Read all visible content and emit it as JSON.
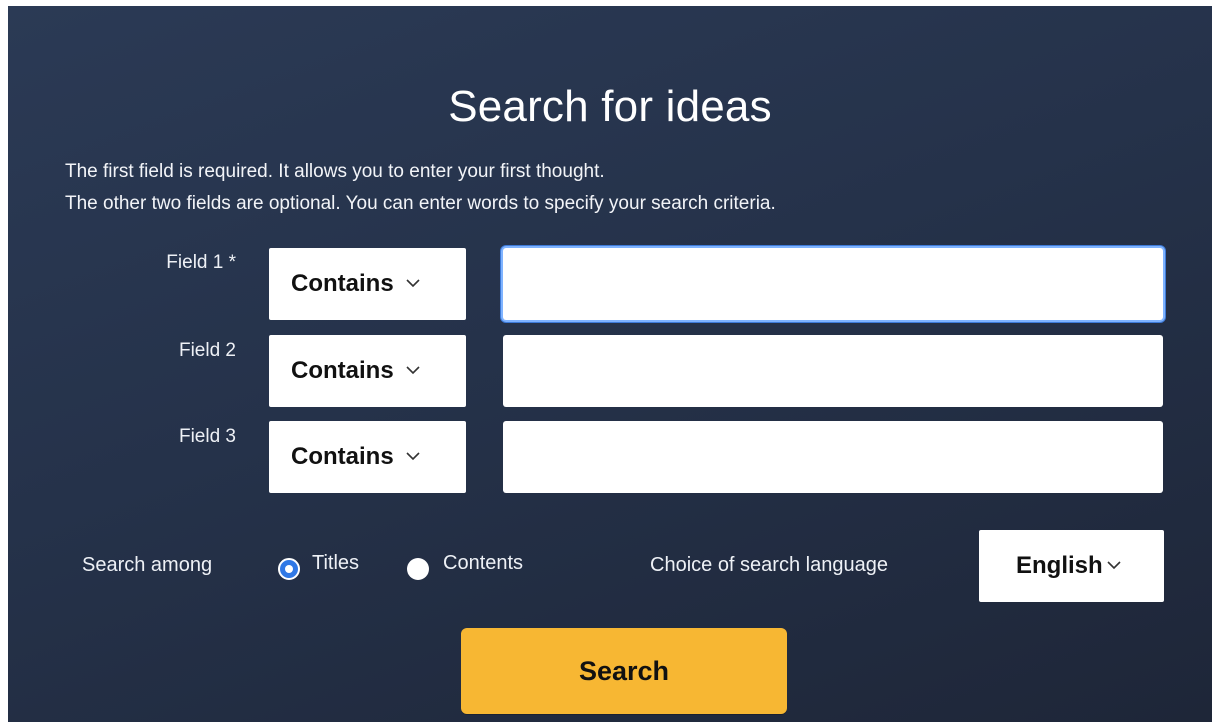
{
  "page": {
    "title": "Search for ideas",
    "description": [
      "The first field is required. It allows you to enter your first thought.",
      "The other two fields are optional. You can enter words to specify your search criteria."
    ]
  },
  "fields": [
    {
      "label": "Field 1 *",
      "operator": "Contains",
      "value": "",
      "focused": true
    },
    {
      "label": "Field 2",
      "operator": "Contains",
      "value": ""
    },
    {
      "label": "Field 3",
      "operator": "Contains",
      "value": ""
    }
  ],
  "search_among": {
    "label": "Search among",
    "options": [
      {
        "label": "Titles",
        "selected": true
      },
      {
        "label": "Contents",
        "selected": false
      }
    ]
  },
  "language": {
    "label": "Choice of search language",
    "selected": "English"
  },
  "search_button": {
    "label": "Search"
  },
  "colors": {
    "background": "#25324a",
    "accent_button": "#f7b733",
    "radio_selected": "#2f78e6",
    "focus_ring": "#3d7ad8"
  },
  "icons": {
    "dropdown": "chevron-down-icon"
  }
}
